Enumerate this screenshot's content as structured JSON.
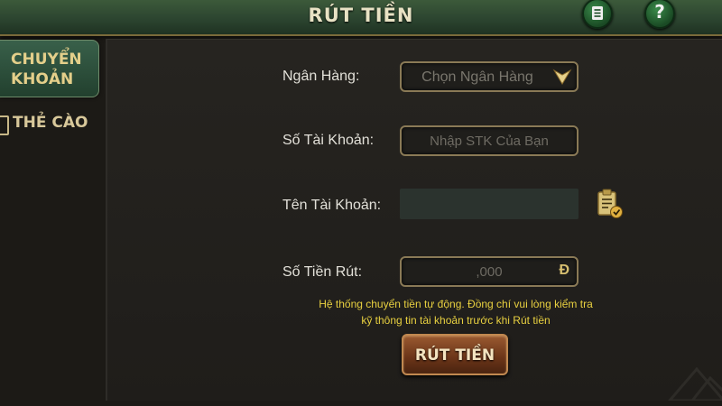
{
  "header": {
    "title": "RÚT TIỀN",
    "list_icon": "list-document-icon",
    "help_label": "?"
  },
  "sidebar": {
    "tabs": [
      {
        "label": "CHUYỂN KHOẢN",
        "active": true
      },
      {
        "label": "THẺ CÀO",
        "active": false,
        "icon": "card-icon"
      }
    ]
  },
  "form": {
    "bank": {
      "label": "Ngân Hàng:",
      "placeholder": "Chọn Ngân Hàng",
      "icon": "chevron-down-icon"
    },
    "account_number": {
      "label": "Số Tài Khoản:",
      "placeholder": "Nhập STK Của Bạn"
    },
    "account_name": {
      "label": "Tên Tài Khoản:",
      "value": "",
      "icon": "clipboard-check-icon"
    },
    "amount": {
      "label": "Số Tiền Rút:",
      "placeholder": ",000",
      "currency": "Đ"
    }
  },
  "notice": {
    "line1": "Hệ thống chuyển tiền tự động. Đồng chí vui lòng kiểm tra",
    "line2": "kỹ thông tin tài khoản trước khi Rút tiền"
  },
  "submit": {
    "label": "RÚT TIỀN"
  },
  "colors": {
    "header_green": "#2c4530",
    "gold_text": "#e4cf8a",
    "notice_yellow": "#e8d040",
    "button_brown": "#6a3418"
  }
}
